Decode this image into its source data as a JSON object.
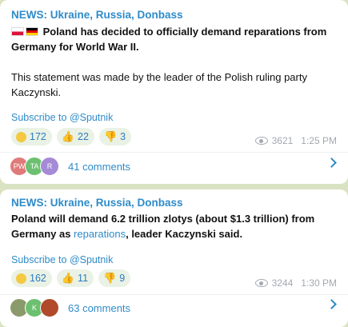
{
  "posts": [
    {
      "channel": "NEWS: Ukraine, Russia, Donbass",
      "line1": "Poland has decided to officially demand reparations from",
      "line2": "Germany for World War II.",
      "line3": "This statement was made by the leader of the Polish ruling party",
      "line4": "Kaczynski.",
      "subscribe": "Subscribe to @Sputnik",
      "reactions": [
        {
          "icon": "grinning-face-icon",
          "count": "172"
        },
        {
          "icon": "thumbs-up-icon",
          "count": "22"
        },
        {
          "icon": "thumbs-down-icon",
          "count": "3"
        }
      ],
      "views": "3621",
      "time": "1:25 PM",
      "avatars": [
        {
          "initials": "PW",
          "color": "#e07a7a"
        },
        {
          "initials": "TA",
          "color": "#6cc070"
        },
        {
          "initials": "R",
          "color": "#a58ad6"
        }
      ],
      "comments": "41 comments"
    },
    {
      "channel": "NEWS: Ukraine, Russia, Donbass",
      "line1": "Poland will demand 6.2 trillion zlotys (about $1.3 trillion) from",
      "line2_pre": "Germany as ",
      "line2_link": "reparations",
      "line2_post": ", leader Kaczynski said.",
      "subscribe": "Subscribe to @Sputnik",
      "reactions": [
        {
          "icon": "grinning-face-icon",
          "count": "162"
        },
        {
          "icon": "thumbs-up-icon",
          "count": "11"
        },
        {
          "icon": "thumbs-down-icon",
          "count": "9"
        }
      ],
      "views": "3244",
      "time": "1:30 PM",
      "avatars": [
        {
          "initials": "",
          "color": "#8a9a6a"
        },
        {
          "initials": "K",
          "color": "#6cc070"
        },
        {
          "initials": "",
          "color": "#b04a2a"
        }
      ],
      "comments": "63 comments"
    }
  ],
  "flags": [
    "poland-flag-icon",
    "germany-flag-icon"
  ]
}
